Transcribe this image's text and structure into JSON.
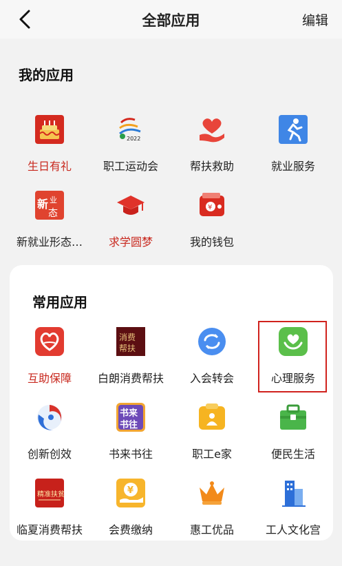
{
  "header": {
    "title": "全部应用",
    "edit_label": "编辑"
  },
  "mine": {
    "title": "我的应用",
    "apps": [
      {
        "label": "生日有礼",
        "icon": "birthday-cake-icon",
        "highlight_text": true
      },
      {
        "label": "职工运动会",
        "icon": "games-2022-logo-icon",
        "highlight_text": false
      },
      {
        "label": "帮扶救助",
        "icon": "heart-hand-icon",
        "highlight_text": false
      },
      {
        "label": "就业服务",
        "icon": "running-person-icon",
        "highlight_text": false
      },
      {
        "label": "新就业形态…",
        "icon": "new-employment-form-icon",
        "highlight_text": false
      },
      {
        "label": "求学圆梦",
        "icon": "graduation-cap-icon",
        "highlight_text": true
      },
      {
        "label": "我的钱包",
        "icon": "wallet-icon",
        "highlight_text": false
      }
    ]
  },
  "common": {
    "title": "常用应用",
    "apps": [
      {
        "label": "互助保障",
        "icon": "mutual-aid-heart-icon",
        "highlight_text": true
      },
      {
        "label": "白朗消费帮扶",
        "icon": "bailang-consumer-support-icon",
        "highlight_text": false
      },
      {
        "label": "入会转会",
        "icon": "transfer-arrows-icon",
        "highlight_text": false
      },
      {
        "label": "心理服务",
        "icon": "psychology-heart-hand-icon",
        "highlight_text": false,
        "selected": true
      },
      {
        "label": "创新创效",
        "icon": "innovation-swirl-icon",
        "highlight_text": false
      },
      {
        "label": "书来书往",
        "icon": "book-exchange-icon",
        "highlight_text": false
      },
      {
        "label": "职工e家",
        "icon": "worker-home-icon",
        "highlight_text": false
      },
      {
        "label": "便民生活",
        "icon": "toolbox-icon",
        "highlight_text": false
      },
      {
        "label": "临夏消费帮扶",
        "icon": "linxia-consumer-support-icon",
        "highlight_text": false
      },
      {
        "label": "会费缴纳",
        "icon": "dues-payment-icon",
        "highlight_text": false
      },
      {
        "label": "惠工优品",
        "icon": "crown-icon",
        "highlight_text": false
      },
      {
        "label": "工人文化宫",
        "icon": "buildings-icon",
        "highlight_text": false
      }
    ]
  },
  "colors": {
    "accent_red": "#c8281e",
    "selection_border": "#d0211c",
    "background": "#f2f2f2"
  }
}
